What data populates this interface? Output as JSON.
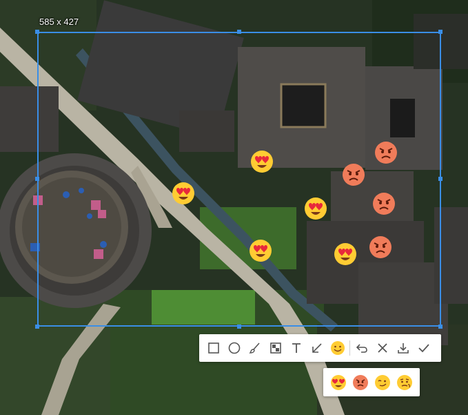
{
  "selection": {
    "size_label": "585 x 427"
  },
  "stickers": [
    "heart-eyes",
    "heart-eyes",
    "heart-eyes",
    "heart-eyes",
    "heart-eyes",
    "angry",
    "angry",
    "angry",
    "angry"
  ],
  "toolbar": {
    "tools": [
      "rectangle-icon",
      "ellipse-icon",
      "brush-icon",
      "mosaic-icon",
      "text-icon",
      "arrow-icon",
      "emoji-icon",
      "undo-icon",
      "cancel-icon",
      "download-icon",
      "confirm-icon"
    ],
    "active_tool": "emoji-icon"
  },
  "emoji_panel": {
    "options": [
      "heart-eyes",
      "angry",
      "wink",
      "confused"
    ]
  },
  "colors": {
    "selection_border": "#3a8ee6",
    "emoji_yellow": "#ffcc33",
    "angry_red": "#f07c5a",
    "toolbar_bg": "#ffffff",
    "icon_gray": "#555555"
  }
}
